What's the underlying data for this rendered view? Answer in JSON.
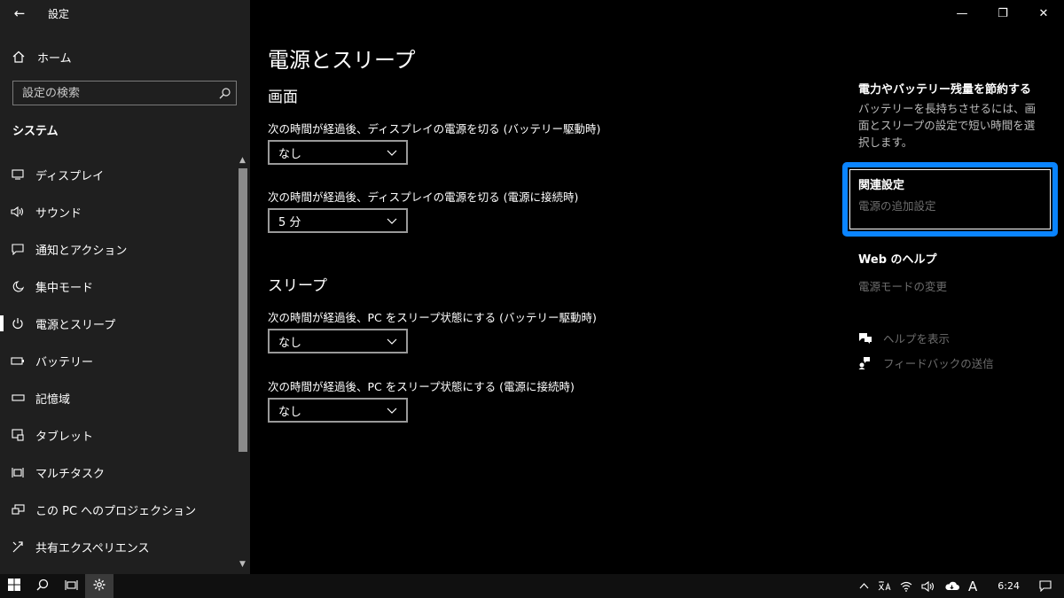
{
  "app": {
    "back_glyph": "←",
    "title": "設定"
  },
  "window_controls": {
    "minimize": "—",
    "restore": "❐",
    "close": "✕"
  },
  "sidebar": {
    "home_label": "ホーム",
    "search_placeholder": "設定の検索",
    "section_title": "システム",
    "items": [
      {
        "label": "ディスプレイ",
        "icon": "display-icon"
      },
      {
        "label": "サウンド",
        "icon": "sound-icon"
      },
      {
        "label": "通知とアクション",
        "icon": "notification-icon"
      },
      {
        "label": "集中モード",
        "icon": "moon-icon"
      },
      {
        "label": "電源とスリープ",
        "icon": "power-icon",
        "active": true
      },
      {
        "label": "バッテリー",
        "icon": "battery-icon"
      },
      {
        "label": "記憶域",
        "icon": "storage-icon"
      },
      {
        "label": "タブレット",
        "icon": "tablet-icon"
      },
      {
        "label": "マルチタスク",
        "icon": "multitask-icon"
      },
      {
        "label": "この PC へのプロジェクション",
        "icon": "projection-icon"
      },
      {
        "label": "共有エクスペリエンス",
        "icon": "shared-icon"
      }
    ]
  },
  "main": {
    "page_title": "電源とスリープ",
    "screen_heading": "画面",
    "screen_battery_label": "次の時間が経過後、ディスプレイの電源を切る (バッテリー駆動時)",
    "screen_battery_value": "なし",
    "screen_plugged_label": "次の時間が経過後、ディスプレイの電源を切る (電源に接続時)",
    "screen_plugged_value": "5 分",
    "sleep_heading": "スリープ",
    "sleep_battery_label": "次の時間が経過後、PC をスリープ状態にする (バッテリー駆動時)",
    "sleep_battery_value": "なし",
    "sleep_plugged_label": "次の時間が経過後、PC をスリープ状態にする (電源に接続時)",
    "sleep_plugged_value": "なし"
  },
  "right_panel": {
    "save_title": "電力やバッテリー残量を節約する",
    "save_text": "バッテリーを長持ちさせるには、画面とスリープの設定で短い時間を選択します。",
    "related_title": "関連設定",
    "related_link": "電源の追加設定",
    "web_help_title": "Web のヘルプ",
    "web_help_link": "電源モードの変更",
    "show_help": "ヘルプを表示",
    "send_feedback": "フィードバックの送信"
  },
  "taskbar": {
    "clock": "6:24",
    "ime": "A",
    "accent_color": "#0a84ff"
  }
}
